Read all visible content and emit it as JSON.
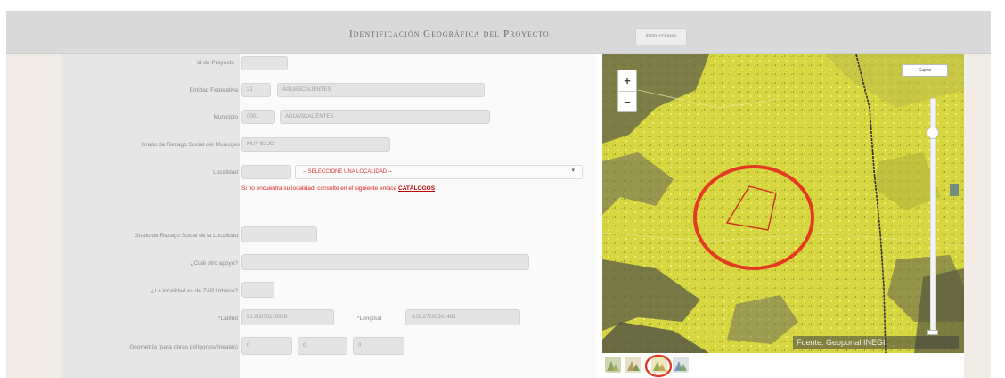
{
  "header": {
    "title": "Identificación Geográfica del Proyecto",
    "button_label": "Instrucciones"
  },
  "form": {
    "labels": {
      "id_proyecto": "Id de Proyecto",
      "entidad": "Entidad Federativa",
      "municipio": "Municipio",
      "grado_municipio": "Grado de Rezago Social del Municipio",
      "localidad": "Localidad",
      "grado_localidad": "Grado de Rezago Social de la Localidad",
      "otro_apoyo": "¿Cuál otro apoyo?",
      "zap": "¿La localidad es de ZAP Urbana?",
      "latitud": "*Latitud",
      "longitud": "*Longitud",
      "geometria": "Geometría (para obras polígonos/lineales)"
    },
    "values": {
      "id_proyecto": "",
      "entidad_clave": "21",
      "entidad_nombre": "AGUASCALIENTES",
      "municipio_clave": "0001",
      "municipio_nombre": "AGUASCALIENTES",
      "grado_municipio": "MUY BAJO",
      "localidad_clave": "",
      "localidad_nombre": "-- SELECCIONE UNA LOCALIDAD --",
      "grado_localidad": "",
      "otro_apoyo": "",
      "zap": "",
      "latitud": "21.86873178058",
      "longitud": "-102.27205301486",
      "geom_1": "0",
      "geom_2": "0",
      "geom_3": "0"
    },
    "warning_text": "Si no encuentra su localidad, consulte en el siguiente enlace",
    "warning_link": "CATÁLOGOS"
  },
  "map": {
    "layers_button": "Capas",
    "zoom_in": "+",
    "zoom_out": "−",
    "caption": "Fuente: Geoportal INEGI",
    "highlight_color": "#e33a22",
    "thumbnails": [
      "satellite-icon",
      "hybrid-icon",
      "terrain-icon",
      "streets-icon"
    ]
  }
}
